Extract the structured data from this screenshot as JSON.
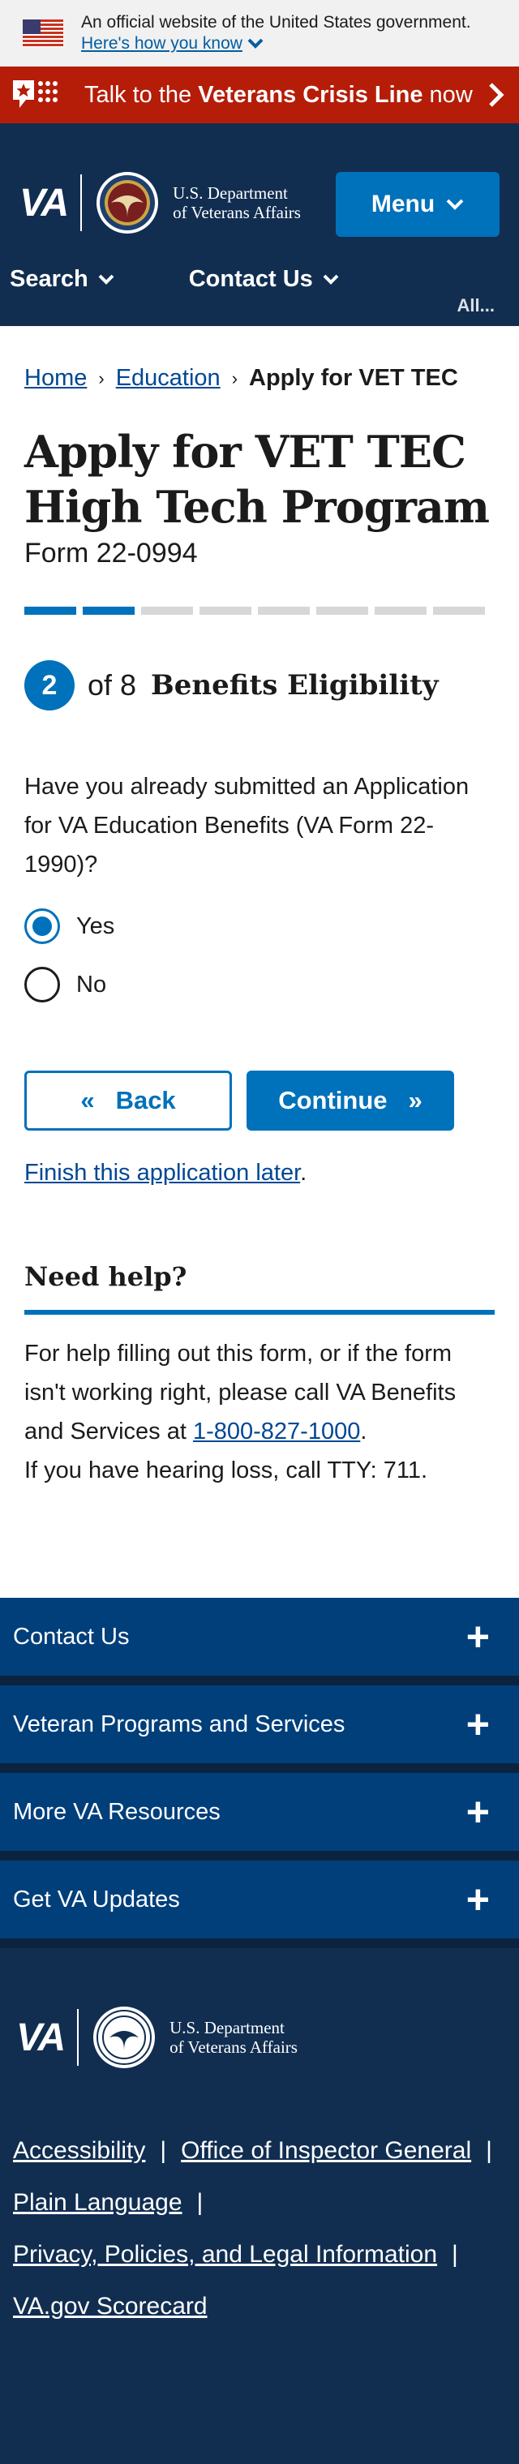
{
  "gov_banner": {
    "text": "An official website of the United States government.",
    "link": "Here's how you know"
  },
  "crisis": {
    "prefix": "Talk to the ",
    "bold": "Veterans Crisis Line",
    "suffix": " now"
  },
  "header": {
    "va_mark": "VA",
    "dept_line1": "U.S. Department",
    "dept_line2": "of Veterans Affairs",
    "menu_label": "Menu",
    "nav": [
      "Search",
      "Contact Us"
    ],
    "nav_cut": "All..."
  },
  "breadcrumb": {
    "home": "Home",
    "education": "Education",
    "current": "Apply for VET TEC"
  },
  "page": {
    "title_line1": "Apply for VET TEC",
    "title_line2": "High Tech Program",
    "form_number": "Form 22-0994",
    "progress_total": 8,
    "progress_done": 2
  },
  "step": {
    "number": "2",
    "of": "of 8",
    "title": "Benefits Eligibility"
  },
  "question": {
    "text": "Have you already submitted an Application for VA Education Benefits (VA Form 22-1990)?",
    "options": [
      "Yes",
      "No"
    ],
    "selected": "Yes"
  },
  "buttons": {
    "back": "Back",
    "continue": "Continue"
  },
  "finish_later": "Finish this application later",
  "help": {
    "title": "Need help?",
    "text": "For help filling out this form, or if the form isn't working right, please call VA Benefits and Services at ",
    "phone": "1-800-827-1000",
    "tty": "If you have hearing loss, call TTY: 711."
  },
  "footer": {
    "accordions": [
      "Contact Us",
      "Veteran Programs and Services",
      "More VA Resources",
      "Get VA Updates"
    ],
    "links": [
      "Accessibility",
      "Office of Inspector General",
      "Plain Language",
      "Privacy, Policies, and Legal Information",
      "VA.gov Scorecard"
    ]
  },
  "colors": {
    "primary": "#0071bb",
    "navy": "#112e51",
    "crisis_red": "#b51d09",
    "footer_accordion": "#003f7a"
  }
}
